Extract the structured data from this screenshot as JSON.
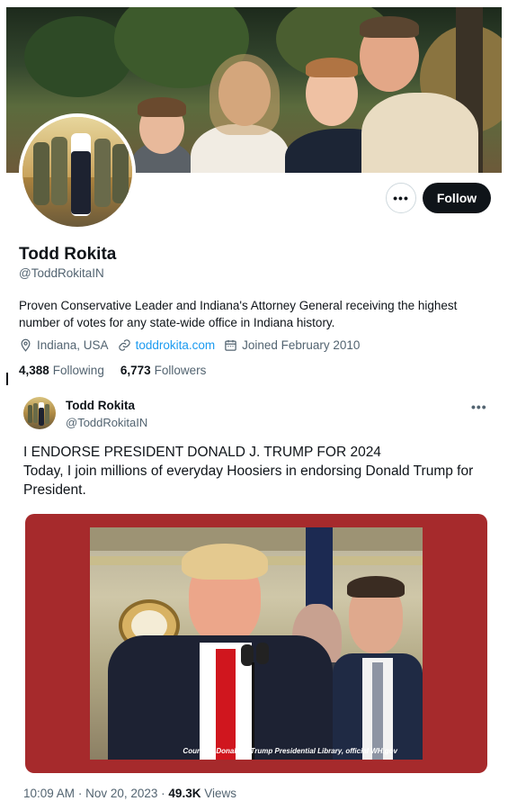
{
  "profile": {
    "name": "Todd Rokita",
    "handle": "@ToddRokitaIN",
    "bio": "Proven Conservative Leader and Indiana's Attorney General receiving the highest number of votes for any state-wide office in Indiana history.",
    "location": "Indiana, USA",
    "website": "toddrokita.com",
    "joined": "Joined February 2010",
    "following_count": "4,388",
    "following_label": "Following",
    "followers_count": "6,773",
    "followers_label": "Followers",
    "follow_button": "Follow",
    "more_button": "•••"
  },
  "post": {
    "author_name": "Todd Rokita",
    "author_handle": "@ToddRokitaIN",
    "more": "•••",
    "line1": "I ENDORSE PRESIDENT DONALD J. TRUMP FOR 2024",
    "line2": "Today, I join millions of everyday Hoosiers in endorsing Donald Trump for President.",
    "media_credit": "Courtesy Donald J. Trump Presidential Library, official WH.gov",
    "time": "10:09 AM",
    "date": "Nov 20, 2023",
    "views_count": "49.3K",
    "views_label": "Views"
  },
  "icons": {
    "location": "location-pin-icon",
    "link": "link-icon",
    "calendar": "calendar-icon"
  },
  "colors": {
    "accent": "#1d9bf0",
    "text": "#0f1419",
    "muted": "#536471",
    "media_background": "#a62a2c"
  }
}
